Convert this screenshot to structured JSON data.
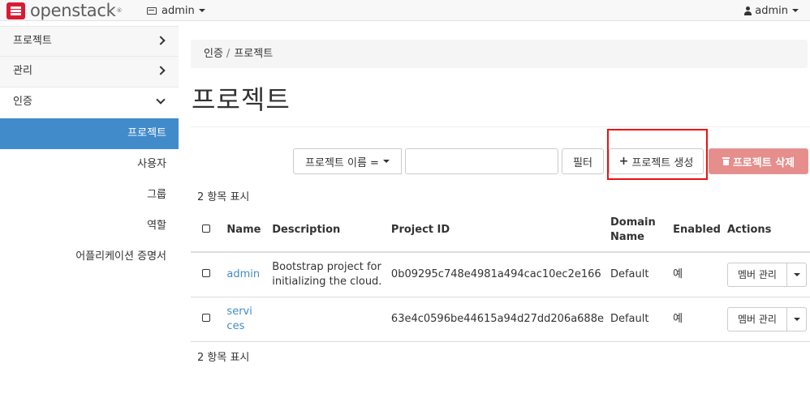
{
  "navbar": {
    "brand": "openstack",
    "brand_mark": "®",
    "project_selector": "admin",
    "user_menu": "admin"
  },
  "sidebar": {
    "dashboards": [
      {
        "label": "프로젝트",
        "expanded": false
      },
      {
        "label": "관리",
        "expanded": false
      },
      {
        "label": "인증",
        "expanded": true
      }
    ],
    "items": [
      {
        "label": "프로젝트",
        "active": true
      },
      {
        "label": "사용자",
        "active": false
      },
      {
        "label": "그룹",
        "active": false
      },
      {
        "label": "역할",
        "active": false
      },
      {
        "label": "어플리케이션 증명서",
        "active": false
      }
    ]
  },
  "breadcrumb": {
    "items": [
      "인증",
      "프로젝트"
    ],
    "separator": "/"
  },
  "page": {
    "title": "프로젝트"
  },
  "toolbar": {
    "filter_field": "프로젝트 이름 =",
    "filter_value": "",
    "filter_button": "필터",
    "create_button": "프로젝트 생성",
    "delete_button": "프로젝트 삭제"
  },
  "table": {
    "count_top": "2 항목 표시",
    "count_bottom": "2 항목 표시",
    "headers": {
      "name": "Name",
      "description": "Description",
      "project_id": "Project ID",
      "domain_name": "Domain Name",
      "enabled": "Enabled",
      "actions": "Actions"
    },
    "rows": [
      {
        "name": "admin",
        "description": "Bootstrap project for initializing the cloud.",
        "project_id": "0b09295c748e4981a494cac10ec2e166",
        "domain_name": "Default",
        "enabled": "예",
        "action": "멤버 관리"
      },
      {
        "name": "services",
        "description": "",
        "project_id": "63e4c0596be44615a94d27dd206a688e",
        "domain_name": "Default",
        "enabled": "예",
        "action": "멤버 관리"
      }
    ]
  },
  "colors": {
    "brand_red": "#da1a32",
    "active_blue": "#428bca",
    "danger_button": "#e58e8b",
    "highlight_box": "#ee1111"
  }
}
